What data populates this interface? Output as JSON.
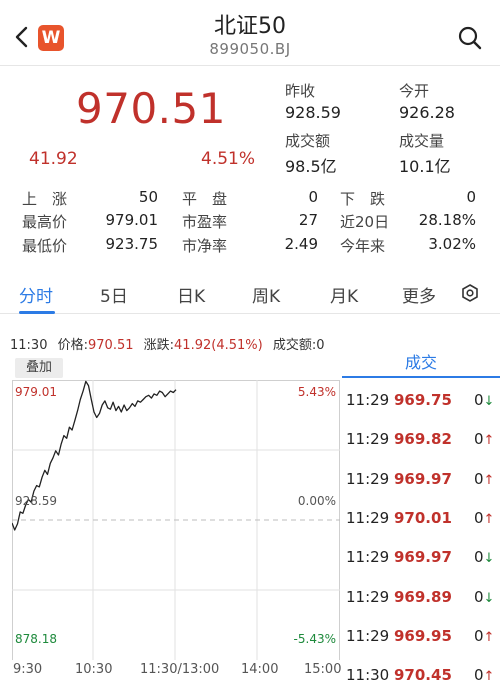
{
  "header": {
    "title": "北证50",
    "code": "899050.BJ",
    "logo_letter": "W"
  },
  "quote": {
    "price": "970.51",
    "change": "41.92",
    "change_pct": "4.51%",
    "prev_close_label": "昨收",
    "prev_close": "928.59",
    "open_label": "今开",
    "open": "926.28",
    "turnover_label": "成交额",
    "turnover": "98.5亿",
    "volume_label": "成交量",
    "volume": "10.1亿"
  },
  "stats": {
    "up_label": "上　涨",
    "up": "50",
    "flat_label": "平　盘",
    "flat": "0",
    "down_label": "下　跌",
    "down": "0",
    "high_label": "最高价",
    "high": "979.01",
    "pe_label": "市盈率",
    "pe": "27",
    "d20_label": "近20日",
    "d20": "28.18%",
    "low_label": "最低价",
    "low": "923.75",
    "pb_label": "市净率",
    "pb": "2.49",
    "ytd_label": "今年来",
    "ytd": "3.02%"
  },
  "tabs": [
    "分时",
    "5日",
    "日K",
    "周K",
    "月K",
    "更多"
  ],
  "info": {
    "time": "11:30",
    "price_label": "价格:",
    "price": "970.51",
    "chg_label": "涨跌:",
    "chg": "41.92(4.51%)",
    "amount_label": "成交额:",
    "amount": "0"
  },
  "chart": {
    "overlay_label": "叠加",
    "y_top_label": "979.01",
    "y_mid_label": "928.59",
    "y_bot_label": "878.18",
    "pct_top": "5.43%",
    "pct_mid": "0.00%",
    "pct_bot": "-5.43%",
    "x_labels": [
      "9:30",
      "10:30",
      "11:30/13:00",
      "14:00",
      "15:00"
    ]
  },
  "chart_data": {
    "type": "line",
    "title": "",
    "xlabel": "",
    "ylabel": "",
    "ylim": [
      878.18,
      979.01
    ],
    "x_ticks": [
      "9:30",
      "10:30",
      "11:30/13:00",
      "14:00",
      "15:00"
    ],
    "minutes": [
      0,
      2,
      4,
      6,
      8,
      10,
      12,
      14,
      16,
      18,
      20,
      22,
      24,
      26,
      28,
      30,
      32,
      34,
      36,
      38,
      40,
      42,
      44,
      46,
      48,
      50,
      52,
      54,
      56,
      58,
      60,
      62,
      64,
      66,
      68,
      70,
      72,
      74,
      76,
      78,
      80,
      82,
      84,
      86,
      88,
      90,
      92,
      94,
      96,
      98,
      100,
      102,
      104,
      106,
      108,
      110,
      112,
      114,
      116,
      118,
      120
    ],
    "values": [
      927.5,
      925.0,
      927.2,
      931.5,
      931.0,
      934.0,
      936.0,
      935.0,
      939.0,
      941.0,
      940.5,
      944.0,
      946.5,
      945.0,
      949.0,
      951.0,
      953.5,
      952.0,
      956.0,
      959.0,
      958.0,
      962.0,
      961.0,
      964.5,
      968.0,
      972.0,
      975.0,
      978.5,
      977.0,
      972.0,
      967.5,
      965.5,
      967.0,
      970.0,
      971.5,
      969.0,
      968.5,
      971.0,
      968.0,
      969.5,
      967.5,
      970.0,
      968.0,
      969.0,
      970.5,
      969.5,
      971.5,
      971.0,
      972.0,
      973.0,
      973.5,
      972.5,
      974.0,
      973.5,
      975.0,
      974.5,
      973.0,
      974.0,
      975.0,
      974.5,
      975.5
    ]
  },
  "trades": {
    "header": "成交",
    "rows": [
      {
        "time": "11:29",
        "price": "969.75",
        "vol": "0",
        "dir": "down"
      },
      {
        "time": "11:29",
        "price": "969.82",
        "vol": "0",
        "dir": "up"
      },
      {
        "time": "11:29",
        "price": "969.97",
        "vol": "0",
        "dir": "up"
      },
      {
        "time": "11:29",
        "price": "970.01",
        "vol": "0",
        "dir": "up"
      },
      {
        "time": "11:29",
        "price": "969.97",
        "vol": "0",
        "dir": "down"
      },
      {
        "time": "11:29",
        "price": "969.89",
        "vol": "0",
        "dir": "down"
      },
      {
        "time": "11:29",
        "price": "969.95",
        "vol": "0",
        "dir": "up"
      },
      {
        "time": "11:30",
        "price": "970.45",
        "vol": "0",
        "dir": "up"
      }
    ]
  },
  "colors": {
    "up": "#c0312b",
    "down": "#1e8a3c",
    "accent": "#2c7be5",
    "line": "#222222"
  }
}
